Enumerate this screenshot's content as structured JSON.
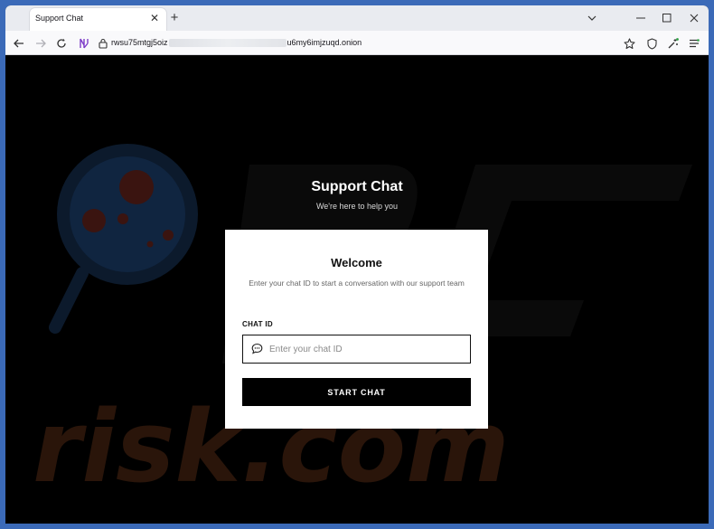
{
  "browser": {
    "tab_title": "Support Chat",
    "url_prefix": "rwsu75mtgj5oiz",
    "url_suffix": "u6my6imjzuqd.onion"
  },
  "hero": {
    "title": "Support Chat",
    "subtitle": "We're here to help you"
  },
  "card": {
    "title": "Welcome",
    "description": "Enter your chat ID to start a conversation with our support team",
    "field_label": "CHAT ID",
    "input_placeholder": "Enter your chat ID",
    "input_value": "",
    "button_label": "START CHAT"
  },
  "watermark": {
    "text": "risk.com"
  },
  "icons": {
    "tab_close": "close-icon",
    "new_tab": "plus-icon",
    "minimize": "minimize-icon",
    "maximize": "maximize-icon",
    "close_window": "close-window-icon",
    "tab_list": "chevron-down-icon",
    "back": "back-arrow-icon",
    "forward": "forward-arrow-icon",
    "reload": "reload-icon",
    "tor_circuit": "tor-onion-icon",
    "lock": "lock-icon",
    "bookmark": "star-icon",
    "shield": "shield-icon",
    "extensions": "wand-icon",
    "menu": "menu-icon",
    "chat": "chat-bubble-icon"
  },
  "colors": {
    "page_background": "#000000",
    "card_background": "#ffffff",
    "button_background": "#000000",
    "frame_blue": "#3b6ab8"
  }
}
